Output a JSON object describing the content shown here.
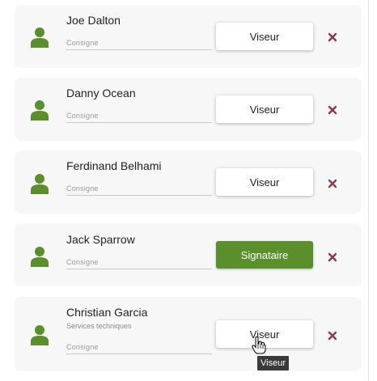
{
  "signers": [
    {
      "name": "Joe Dalton",
      "subtitle": "",
      "consigne_placeholder": "Consigne",
      "role": "Viseur",
      "role_state": "viseur"
    },
    {
      "name": "Danny Ocean",
      "subtitle": "",
      "consigne_placeholder": "Consigne",
      "role": "Viseur",
      "role_state": "viseur"
    },
    {
      "name": "Ferdinand Belhami",
      "subtitle": "",
      "consigne_placeholder": "Consigne",
      "role": "Viseur",
      "role_state": "viseur"
    },
    {
      "name": "Jack Sparrow",
      "subtitle": "",
      "consigne_placeholder": "Consigne",
      "role": "Signataire",
      "role_state": "signataire"
    },
    {
      "name": "Christian Garcia",
      "subtitle": "Services techniques",
      "consigne_placeholder": "Consigne",
      "role": "Viseur",
      "role_state": "viseur"
    }
  ],
  "tooltip": "Viseur",
  "colors": {
    "avatar": "#5b8f2b",
    "signataire_bg": "#5b8f2b",
    "remove": "#8b3a4e"
  },
  "icons": {
    "avatar": "user-icon",
    "remove": "close-icon",
    "cursor": "hand-pointer-icon"
  }
}
